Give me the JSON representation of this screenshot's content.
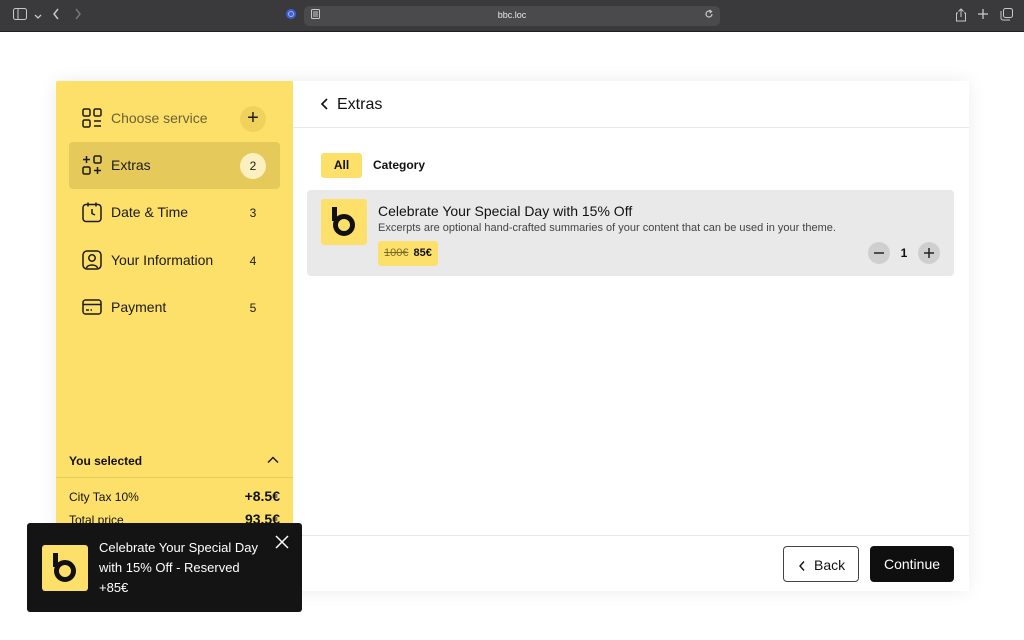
{
  "browser": {
    "url": "bbc.loc",
    "icons": [
      "sidebar-icon",
      "chevron-down-icon",
      "back-icon",
      "forward-icon",
      "shield-icon",
      "reader-icon",
      "reload-icon",
      "share-icon",
      "new-tab-icon",
      "tabs-icon"
    ]
  },
  "sidebar": {
    "steps": [
      {
        "label": "Choose service",
        "badge": "+",
        "icon": "grid-icon",
        "state": "disabled"
      },
      {
        "label": "Extras",
        "badge": "2",
        "icon": "extras-icon",
        "state": "active"
      },
      {
        "label": "Date & Time",
        "badge": "3",
        "icon": "calendar-clock-icon",
        "state": "normal"
      },
      {
        "label": "Your Information",
        "badge": "4",
        "icon": "user-icon",
        "state": "normal"
      },
      {
        "label": "Payment",
        "badge": "5",
        "icon": "card-icon",
        "state": "normal"
      }
    ],
    "summary": {
      "heading": "You selected",
      "rows": [
        {
          "label": "City Tax 10%",
          "value": "+8.5€"
        },
        {
          "label": "Total price",
          "value": "93.5€"
        }
      ]
    }
  },
  "main": {
    "title": "Extras",
    "tabs": [
      {
        "label": "All",
        "active": true
      },
      {
        "label": "Category",
        "active": false
      }
    ],
    "items": [
      {
        "title": "Celebrate Your Special Day with 15% Off",
        "description": "Excerpts are optional hand-crafted summaries of your content that can be used in your theme.",
        "old_price": "100€",
        "new_price": "85€",
        "quantity": "1"
      }
    ],
    "buttons": {
      "back": "Back",
      "continue": "Continue"
    }
  },
  "toast": {
    "message": "Celebrate Your Special Day with 15% Off - Reserved +85€"
  },
  "colors": {
    "accent": "#fde06a",
    "accent_active": "#e5c95b",
    "dark": "#0f0f0f"
  }
}
